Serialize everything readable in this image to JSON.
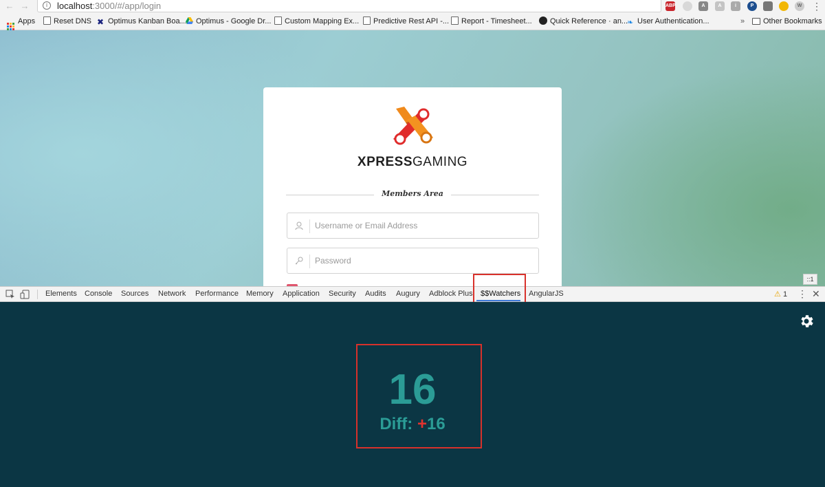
{
  "browser": {
    "url_host": "localhost",
    "url_path": ":3000/#/app/login",
    "extensions": [
      "ABP",
      "A",
      "A",
      "i",
      "P",
      "W"
    ]
  },
  "bookmarks": [
    {
      "label": "Apps"
    },
    {
      "label": "Reset DNS"
    },
    {
      "label": "Optimus Kanban Boa..."
    },
    {
      "label": "Optimus - Google Dr..."
    },
    {
      "label": "Custom Mapping Ex..."
    },
    {
      "label": "Predictive Rest API -..."
    },
    {
      "label": "Report - Timesheet..."
    },
    {
      "label": "Quick Reference · an..."
    },
    {
      "label": "User Authentication..."
    },
    {
      "label": "»"
    },
    {
      "label": "Other Bookmarks"
    }
  ],
  "login": {
    "brand_bold": "XPRESS",
    "brand_light": "GAMING",
    "section_title": "Members Area",
    "username_placeholder": "Username or Email Address",
    "password_placeholder": "Password"
  },
  "devtools": {
    "tabs": [
      "Elements",
      "Console",
      "Sources",
      "Network",
      "Performance",
      "Memory",
      "Application",
      "Security",
      "Audits",
      "Augury",
      "Adblock Plus",
      "$$Watchers",
      "AngularJS"
    ],
    "active_tab": "$$Watchers",
    "warning_count": "1",
    "coords_label": "::1",
    "watchers": {
      "count": "16",
      "diff_label": "Diff:",
      "diff_sign": "+",
      "diff_value": "16"
    }
  },
  "colors": {
    "panel_bg": "#0b3644",
    "count_color": "#2b9c96",
    "diff_sign_color": "#e2332f",
    "highlight": "#d8312b"
  }
}
